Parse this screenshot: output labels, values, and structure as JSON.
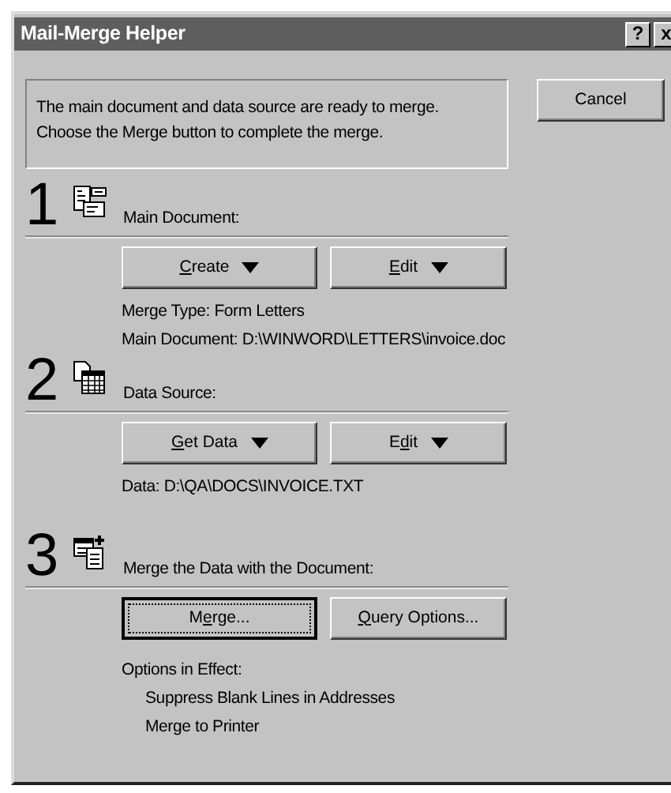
{
  "window": {
    "title": "Mail-Merge Helper",
    "title_buttons": [
      "?",
      "x"
    ]
  },
  "message": [
    "The main document and data source are ready to merge.",
    "Choose the Merge button to complete the merge."
  ],
  "cancel_button": {
    "label": "Cancel"
  },
  "steps": [
    {
      "number": "1",
      "kind": "document",
      "label": "Main Document:",
      "buttons": [
        {
          "key": "C",
          "after": "reate",
          "dropdown": true,
          "focused": false
        },
        {
          "key": "E",
          "after": "dit",
          "dropdown": true,
          "focused": false
        }
      ],
      "info": [
        "Merge Type: Form Letters",
        "Main Document: D:\\WINWORD\\LETTERS\\invoice.doc"
      ]
    },
    {
      "number": "2",
      "kind": "data",
      "label": "Data Source:",
      "buttons": [
        {
          "key": "G",
          "after": "et Data",
          "dropdown": true,
          "focused": false
        },
        {
          "before": "E",
          "key": "d",
          "after": "it",
          "dropdown": true,
          "focused": false
        }
      ],
      "info": [
        "Data: D:\\QA\\DOCS\\INVOICE.TXT"
      ]
    },
    {
      "number": "3",
      "kind": "merge",
      "label": "Merge the Data with the Document:",
      "buttons": [
        {
          "before": "M",
          "key": "e",
          "after": "rge...",
          "dropdown": false,
          "focused": true
        },
        {
          "key": "Q",
          "after": "uery Options...",
          "dropdown": false,
          "focused": false
        }
      ],
      "info": [
        "Options in Effect:"
      ],
      "options": [
        "Suppress Blank Lines in Addresses",
        "Merge to Printer"
      ]
    }
  ]
}
